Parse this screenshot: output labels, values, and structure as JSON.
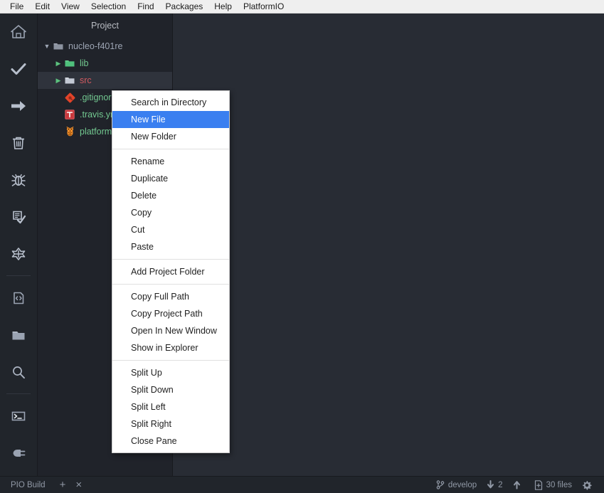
{
  "menubar": {
    "items": [
      {
        "label": "File"
      },
      {
        "label": "Edit"
      },
      {
        "label": "View"
      },
      {
        "label": "Selection"
      },
      {
        "label": "Find"
      },
      {
        "label": "Packages"
      },
      {
        "label": "Help"
      },
      {
        "label": "PlatformIO"
      }
    ]
  },
  "dock": {
    "icons": [
      {
        "name": "home-icon"
      },
      {
        "name": "check-icon"
      },
      {
        "name": "arrow-right-icon"
      },
      {
        "name": "trash-icon"
      },
      {
        "name": "bug-icon"
      },
      {
        "name": "clipboard-check-icon"
      },
      {
        "name": "serial-monitor-icon"
      },
      {
        "name": "code-file-icon"
      },
      {
        "name": "folder-icon"
      },
      {
        "name": "search-icon"
      },
      {
        "name": "terminal-icon"
      },
      {
        "name": "plug-icon"
      }
    ]
  },
  "tree": {
    "title": "Project",
    "nodes": [
      {
        "label": "nucleo-f401re",
        "type": "folder",
        "state": "expanded",
        "depth": 0,
        "color": "grey",
        "icon": "folder-open-icon"
      },
      {
        "label": "lib",
        "type": "folder",
        "state": "collapsed",
        "depth": 1,
        "color": "green",
        "icon": "folder-icon"
      },
      {
        "label": "src",
        "type": "folder",
        "state": "collapsed",
        "depth": 1,
        "color": "red",
        "icon": "folder-icon",
        "selected": true
      },
      {
        "label": ".gitignore",
        "type": "file",
        "depth": 1,
        "color": "green",
        "icon": "git-icon"
      },
      {
        "label": ".travis.yml",
        "type": "file",
        "depth": 1,
        "color": "green",
        "icon": "travis-icon"
      },
      {
        "label": "platformio.ini",
        "type": "file",
        "depth": 1,
        "color": "green",
        "icon": "platformio-icon"
      }
    ]
  },
  "context_menu": {
    "groups": [
      {
        "items": [
          {
            "label": "Search in Directory",
            "highlighted": false
          },
          {
            "label": "New File",
            "highlighted": true
          },
          {
            "label": "New Folder",
            "highlighted": false
          }
        ]
      },
      {
        "items": [
          {
            "label": "Rename",
            "highlighted": false
          },
          {
            "label": "Duplicate",
            "highlighted": false
          },
          {
            "label": "Delete",
            "highlighted": false
          },
          {
            "label": "Copy",
            "highlighted": false
          },
          {
            "label": "Cut",
            "highlighted": false
          },
          {
            "label": "Paste",
            "highlighted": false
          }
        ]
      },
      {
        "items": [
          {
            "label": "Add Project Folder",
            "highlighted": false
          }
        ]
      },
      {
        "items": [
          {
            "label": "Copy Full Path",
            "highlighted": false
          },
          {
            "label": "Copy Project Path",
            "highlighted": false
          },
          {
            "label": "Open In New Window",
            "highlighted": false
          },
          {
            "label": "Show in Explorer",
            "highlighted": false
          }
        ]
      },
      {
        "items": [
          {
            "label": "Split Up",
            "highlighted": false
          },
          {
            "label": "Split Down",
            "highlighted": false
          },
          {
            "label": "Split Left",
            "highlighted": false
          },
          {
            "label": "Split Right",
            "highlighted": false
          },
          {
            "label": "Close Pane",
            "highlighted": false
          }
        ]
      }
    ]
  },
  "statusbar": {
    "build_label": "PIO Build",
    "add_label": "+",
    "close_label": "×",
    "branch": "develop",
    "behind_count": "2",
    "ahead_count": "",
    "files": "30 files",
    "icons": {
      "branch": "git-branch-icon",
      "down": "arrow-down-icon",
      "up": "arrow-up-icon",
      "file": "file-diff-icon",
      "gear": "gear-icon"
    }
  },
  "colors": {
    "menubar_bg": "#efefef",
    "dock_bg": "#21252b",
    "tree_bg": "#20232a",
    "editor_bg": "#282c34",
    "statusbar_bg": "#21252b",
    "highlight_blue": "#3a7ff0",
    "git_green": "#73c991",
    "git_red": "#d15a60"
  }
}
